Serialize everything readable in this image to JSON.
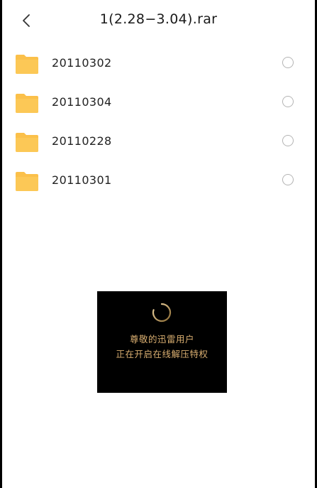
{
  "header": {
    "title": "1(2.28−3.04).rar",
    "back_icon": "chevron-left-icon"
  },
  "files": [
    {
      "name": "20110302",
      "icon": "folder-icon",
      "selected": false
    },
    {
      "name": "20110304",
      "icon": "folder-icon",
      "selected": false
    },
    {
      "name": "20110228",
      "icon": "folder-icon",
      "selected": false
    },
    {
      "name": "20110301",
      "icon": "folder-icon",
      "selected": false
    }
  ],
  "toast": {
    "line1": "尊敬的迅雷用户",
    "line2": "正在开启在线解压特权",
    "icon": "loading-spinner-icon"
  },
  "colors": {
    "folder": "#fbc04a",
    "toast_bg": "#000000",
    "toast_text": "#d9ae70",
    "radio_border": "#b4b4b4"
  }
}
